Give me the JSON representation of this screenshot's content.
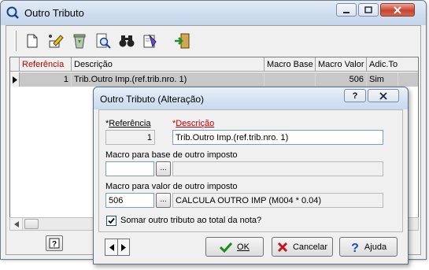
{
  "main_window": {
    "title": "Outro Tributo",
    "icon": "app-magnifier-icon",
    "toolbar_icons": [
      "new-document-icon",
      "edit-pencil-icon",
      "recycle-bin-icon",
      "search-document-icon",
      "binoculars-icon",
      "print-icon",
      "exit-door-icon"
    ]
  },
  "grid": {
    "columns": [
      "Referência",
      "Descrição",
      "Macro Base",
      "Macro Valor",
      "Adic.To"
    ],
    "rows": [
      {
        "referencia": "1",
        "descricao": "Trib.Outro Imp.(ref.trib.nro. 1)",
        "macro_base": "",
        "macro_valor": "506",
        "adic_total": "Sim"
      }
    ]
  },
  "dialog": {
    "title": "Outro Tributo (Alteração)",
    "referencia_label_prefix": "*",
    "referencia_label": "Referência",
    "referencia_value": "1",
    "descricao_label_prefix": "*",
    "descricao_label": "Descrição",
    "descricao_value": "Trib.Outro Imp.(ref.trib.nro. 1)",
    "macro_base_label": "Macro para base de outro imposto",
    "macro_base_code": "",
    "macro_base_desc": "",
    "macro_valor_label": "Macro para valor de outro imposto",
    "macro_valor_code": "506",
    "macro_valor_desc": "CALCULA OUTRO IMP (M004 * 0.04)",
    "dots_label": "...",
    "checkbox_label": "Somar outro tributo ao total da nota?",
    "checkbox_checked": true,
    "ok_label": "OK",
    "cancel_label": "Cancelar",
    "help_label": "Ajuda"
  },
  "colors": {
    "required": "#c00000",
    "selected_row": "#c8c8c8",
    "title_bar": "#cddcee"
  }
}
